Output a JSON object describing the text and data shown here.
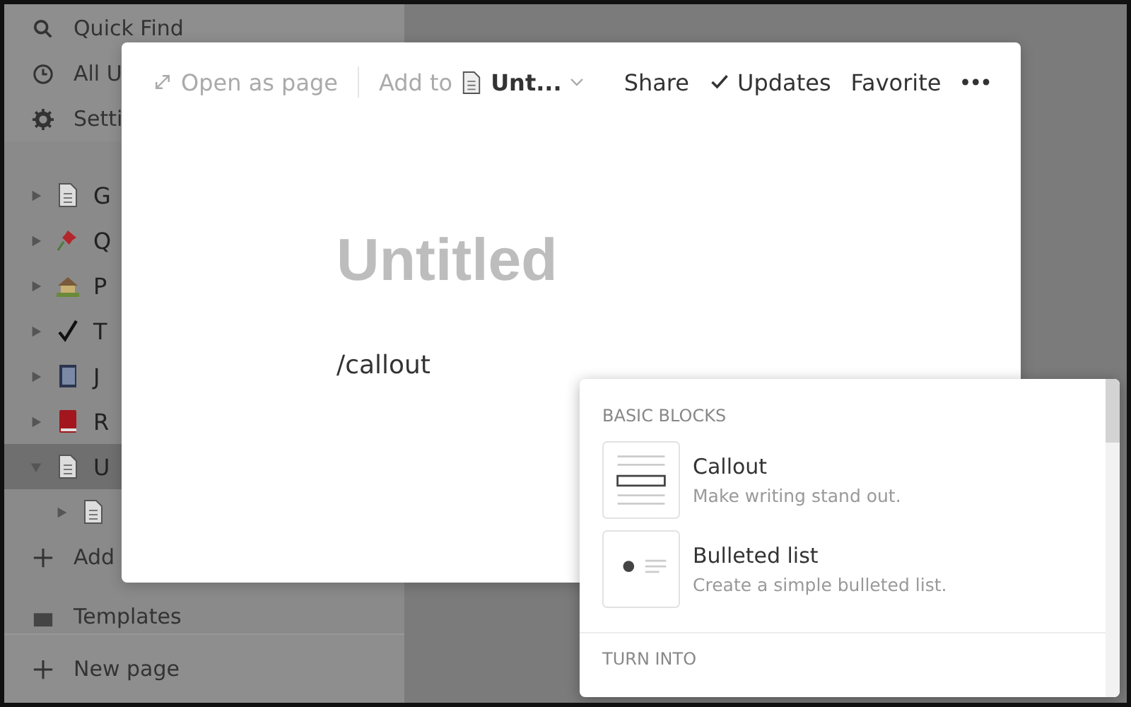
{
  "sidebar": {
    "top_items": [
      {
        "kind": "search",
        "label": "Quick Find"
      },
      {
        "kind": "clock",
        "label": "All U"
      },
      {
        "kind": "gear",
        "label": "Setti"
      }
    ],
    "pages": [
      {
        "label": "G",
        "kind": "doc",
        "expanded": false,
        "selected": false
      },
      {
        "label": "Q",
        "kind": "pin",
        "expanded": false,
        "selected": false
      },
      {
        "label": "P",
        "kind": "house",
        "expanded": false,
        "selected": false
      },
      {
        "label": "T",
        "kind": "check",
        "expanded": false,
        "selected": false
      },
      {
        "label": "J",
        "kind": "notebook",
        "expanded": false,
        "selected": false
      },
      {
        "label": "R",
        "kind": "book",
        "expanded": false,
        "selected": false
      },
      {
        "label": "U",
        "kind": "doc",
        "expanded": true,
        "selected": true,
        "children": [
          {
            "kind": "doc",
            "expanded": false,
            "selected": false
          }
        ]
      }
    ],
    "add_label": "Add",
    "templates_label": "Templates",
    "new_page_label": "New page"
  },
  "modal": {
    "open_as_page": "Open as page",
    "add_to": "Add to",
    "target": "Unt...",
    "share": "Share",
    "updates": "Updates",
    "favorite": "Favorite",
    "placeholder": "Untitled",
    "line": "/callout"
  },
  "menu": {
    "sections": [
      {
        "title": "BASIC BLOCKS",
        "items": [
          {
            "kind": "callout",
            "title": "Callout",
            "description": "Make writing stand out."
          },
          {
            "kind": "bulleted",
            "title": "Bulleted list",
            "description": "Create a simple bulleted list."
          }
        ]
      },
      {
        "title": "TURN INTO"
      }
    ]
  }
}
